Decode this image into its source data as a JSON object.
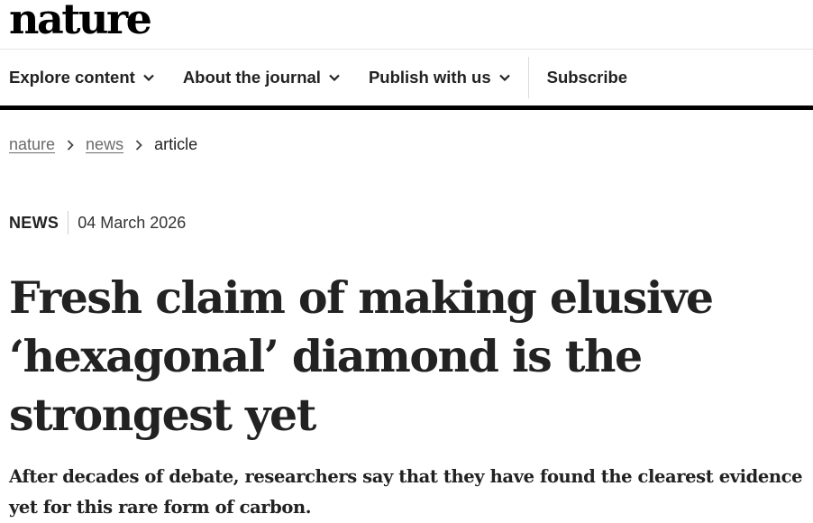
{
  "site": {
    "logo": "nature"
  },
  "nav": {
    "items": [
      {
        "label": "Explore content",
        "has_dropdown": true
      },
      {
        "label": "About the journal",
        "has_dropdown": true
      },
      {
        "label": "Publish with us",
        "has_dropdown": true
      }
    ],
    "subscribe": "Subscribe"
  },
  "breadcrumb": {
    "items": [
      "nature",
      "news",
      "article"
    ]
  },
  "article": {
    "type": "NEWS",
    "date": "04 March 2026",
    "headline": "Fresh claim of making elusive ‘hexagonal’ diamond is the strongest yet",
    "standfirst": "After decades of debate, researchers say that they have found the clearest evidence yet for this rare form of carbon."
  },
  "icons": {
    "dropdown": "chevron-down-icon",
    "breadcrumb_separator": "chevron-right-icon"
  }
}
